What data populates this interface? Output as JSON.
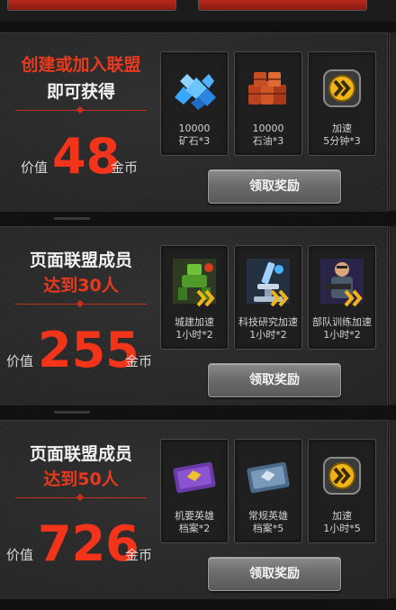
{
  "sections": [
    {
      "line1": "创建或加入联盟",
      "line2": "即可获得",
      "value_label": "价值",
      "value_number": "48",
      "value_unit": "金币",
      "items": [
        {
          "icon": "blue-crystal-ore-icon",
          "line1": "10000",
          "line2": "矿石*3"
        },
        {
          "icon": "oil-barrels-icon",
          "line1": "10000",
          "line2": "石油*3"
        },
        {
          "icon": "speedup-arrow-badge-icon",
          "line1": "加速",
          "line2": "5分钟*3"
        }
      ],
      "button": "领取奖励"
    },
    {
      "line1": "页面联盟成员",
      "line2": "达到30人",
      "value_label": "价值",
      "value_number": "255",
      "value_unit": "金币",
      "items": [
        {
          "icon": "construction-robot-speedup-icon",
          "line1": "城建加速",
          "line2": "1小时*2"
        },
        {
          "icon": "research-microscope-speedup-icon",
          "line1": "科技研究加速",
          "line2": "1小时*2"
        },
        {
          "icon": "soldier-training-speedup-icon",
          "line1": "部队训练加速",
          "line2": "1小时*2"
        }
      ],
      "button": "领取奖励"
    },
    {
      "line1": "页面联盟成员",
      "line2": "达到50人",
      "value_label": "价值",
      "value_number": "726",
      "value_unit": "金币",
      "items": [
        {
          "icon": "purple-hero-file-icon",
          "line1": "机要英雄",
          "line2": "档案*2"
        },
        {
          "icon": "blue-hero-file-icon",
          "line1": "常规英雄",
          "line2": "档案*5"
        },
        {
          "icon": "speedup-arrow-badge-icon",
          "line1": "加速",
          "line2": "1小时*5"
        }
      ],
      "button": "领取奖励"
    }
  ]
}
